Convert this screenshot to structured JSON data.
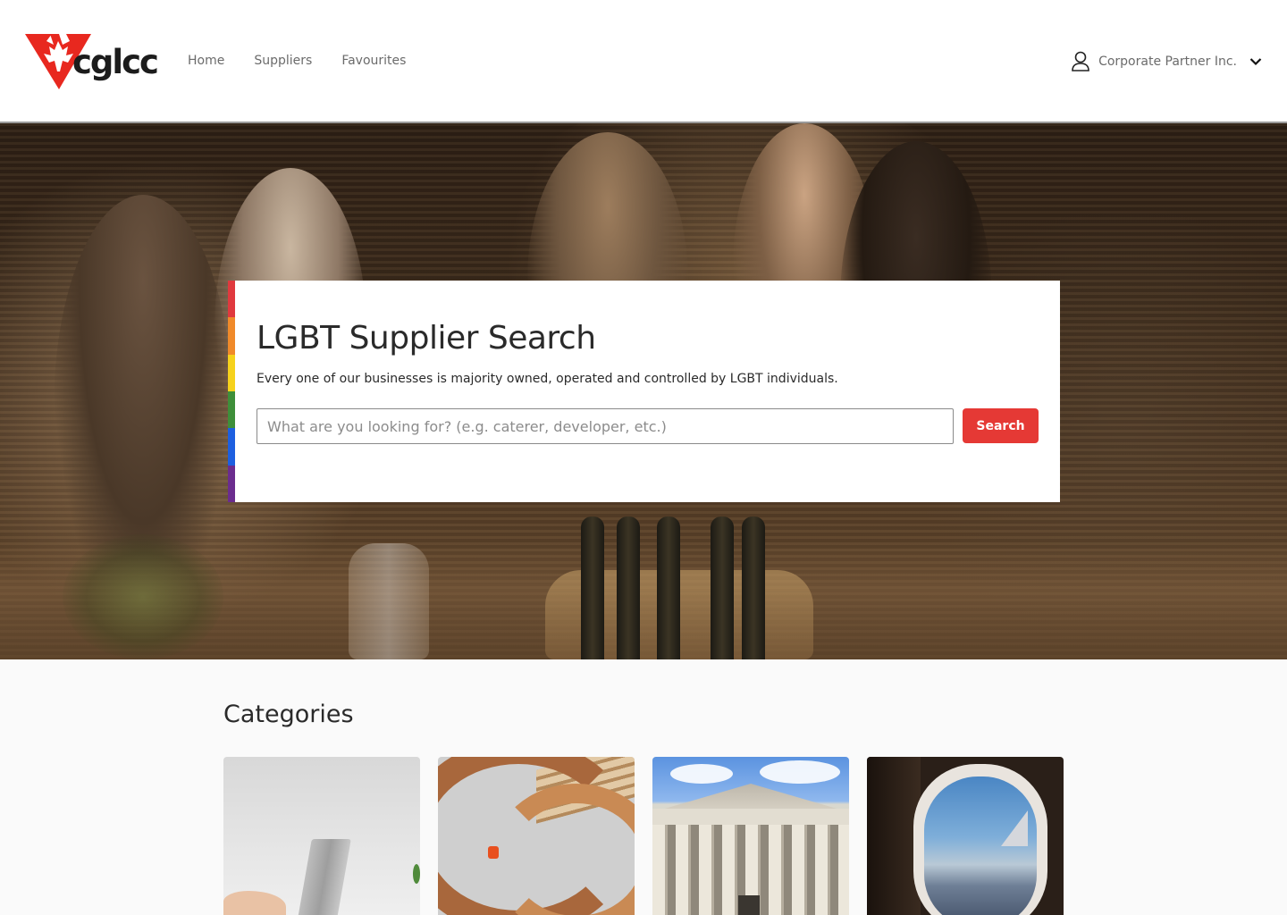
{
  "brand": {
    "logo_text": "cglcc",
    "accent": "#e53935"
  },
  "nav": {
    "items": [
      {
        "label": "Home"
      },
      {
        "label": "Suppliers"
      },
      {
        "label": "Favourites"
      }
    ]
  },
  "user": {
    "name": "Corporate Partner Inc.",
    "icon": "user-icon",
    "dropdown_icon": "chevron-down-icon"
  },
  "hero": {
    "title": "LGBT Supplier Search",
    "subtitle": "Every one of our businesses is majority owned, operated and controlled by LGBT individuals.",
    "search_placeholder": "What are you looking for? (e.g. caterer, developer, etc.)",
    "search_value": "",
    "search_button": "Search",
    "rainbow_colors": [
      "#e0393e",
      "#f08a2a",
      "#f6d21c",
      "#3e8f3a",
      "#1d5fe0",
      "#6b2c8e"
    ]
  },
  "categories": {
    "title": "Categories",
    "cards": [
      {
        "image": "laptop-desk"
      },
      {
        "image": "spiral-staircase"
      },
      {
        "image": "courthouse"
      },
      {
        "image": "airplane-window"
      }
    ]
  }
}
